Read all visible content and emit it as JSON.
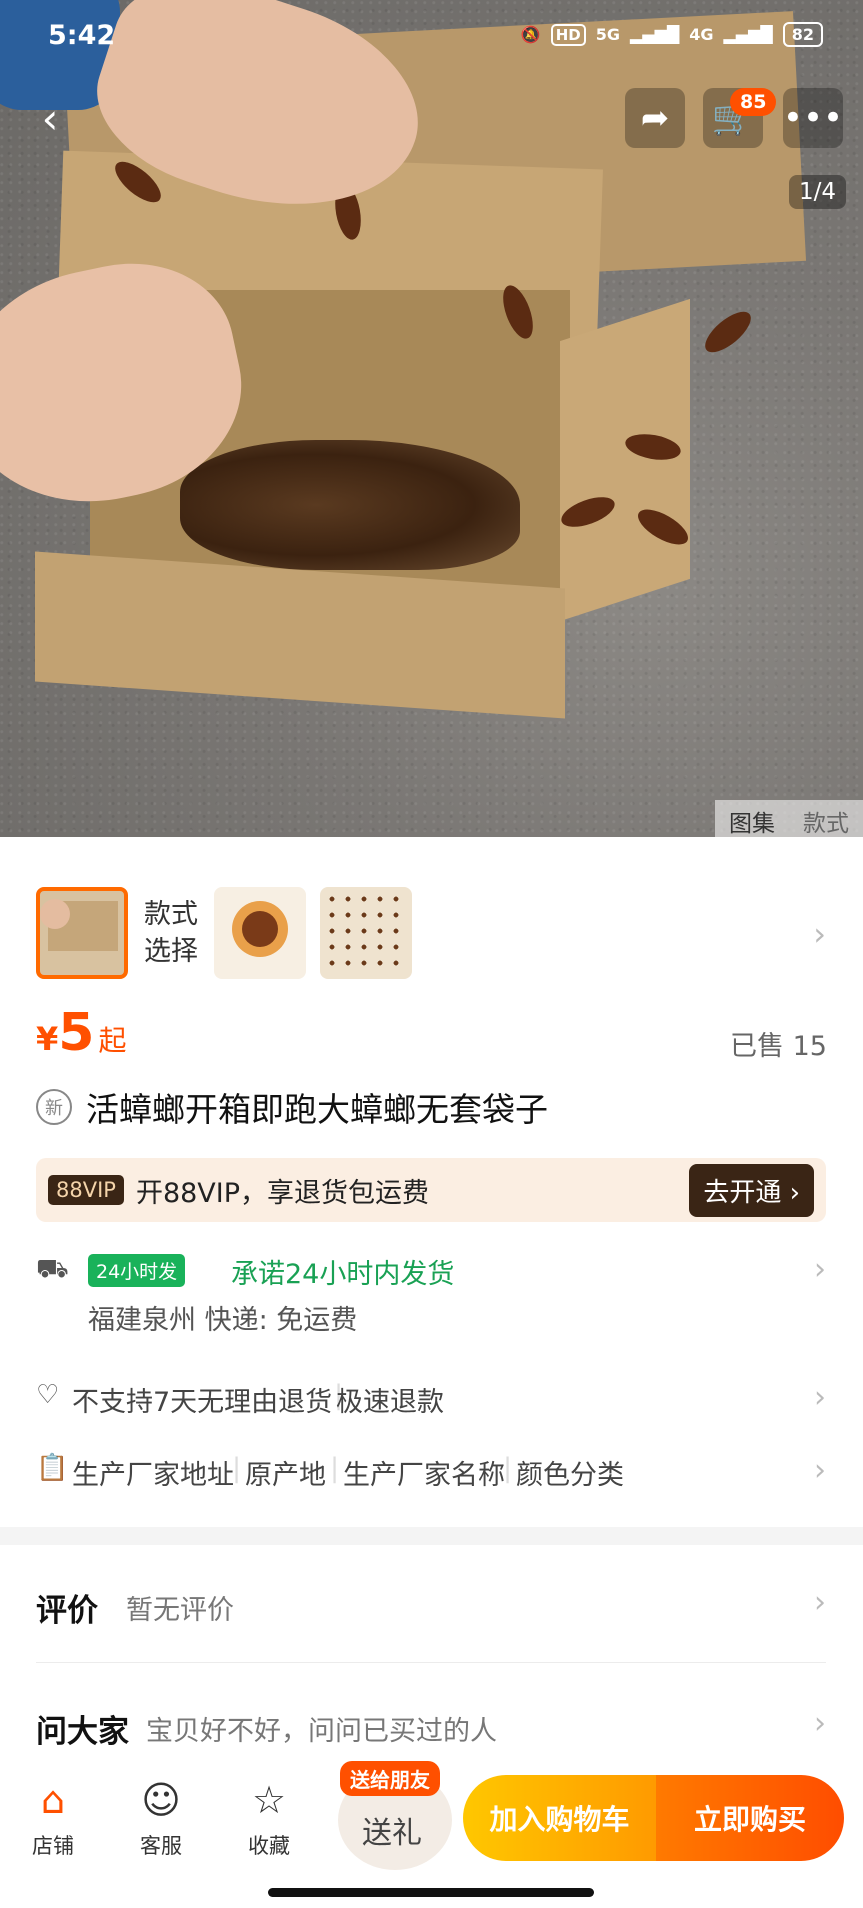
{
  "status_bar": {
    "time": "5:42",
    "hd": "HD",
    "net1": "5G",
    "net2": "4G",
    "battery": "82"
  },
  "header": {
    "cart_count": "85",
    "image_counter": "1/4"
  },
  "gallery_tabs": [
    "图集",
    "款式"
  ],
  "variants": {
    "label_line1": "款式",
    "label_line2": "选择"
  },
  "price": {
    "symbol": "¥",
    "value": "5",
    "suffix": "起",
    "sold": "已售 15"
  },
  "product": {
    "new_badge": "新",
    "title": "活蟑螂开箱即跑大蟑螂无套袋子"
  },
  "vip": {
    "tag": "88VIP",
    "text": "开88VIP，享退货包运费",
    "button": "去开通 ›"
  },
  "shipping": {
    "badge": "24小时发",
    "promise": "承诺24小时内发货",
    "origin": "福建泉州  快递: 免运费"
  },
  "returns": {
    "policy": "不支持7天无理由退货",
    "refund": "极速退款"
  },
  "attributes": [
    "生产厂家地址",
    "原产地",
    "生产厂家名称",
    "颜色分类"
  ],
  "reviews": {
    "title": "评价",
    "subtitle": "暂无评价"
  },
  "ask": {
    "title": "问大家",
    "subtitle": "宝贝好不好，问问已买过的人"
  },
  "bottom_bar": {
    "shop": "店铺",
    "service": "客服",
    "favorite": "收藏",
    "gift_tag": "送给朋友",
    "gift": "送礼",
    "add_to_cart": "加入购物车",
    "buy_now": "立即购买"
  },
  "colors": {
    "accent": "#ff5000",
    "green": "#19b25a",
    "vip_dark": "#3a2515"
  },
  "icons": [
    "back-icon",
    "share-icon",
    "cart-icon",
    "more-icon",
    "truck-icon",
    "heart-icon",
    "clipboard-icon",
    "shop-icon",
    "service-icon",
    "star-icon",
    "chevron-right-icon"
  ]
}
